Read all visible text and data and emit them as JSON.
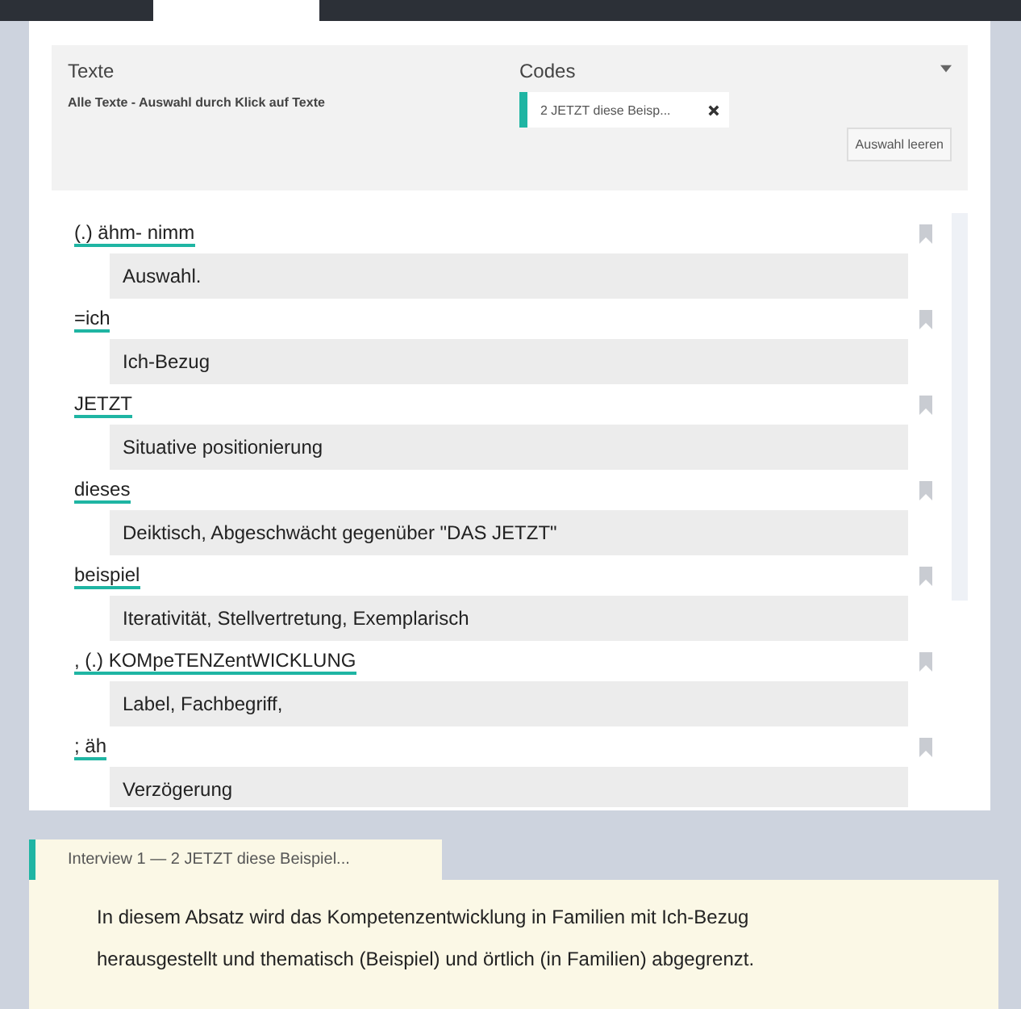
{
  "filter": {
    "texts_label": "Texte",
    "texts_value": "Alle Texte - Auswahl durch Klick auf Texte",
    "codes_label": "Codes",
    "codes": [
      {
        "label": "2 JETZT diese Beisp...",
        "color": "#1fb5a3"
      }
    ],
    "clear_button": "Auswahl leeren"
  },
  "segments": [
    {
      "text": "(.) ähm- nimm",
      "memo": "Auswahl."
    },
    {
      "text": "=ich",
      "memo": "Ich-Bezug"
    },
    {
      "text": "JETZT",
      "memo": "Situative positionierung"
    },
    {
      "text": "dieses",
      "memo": "Deiktisch, Abgeschwächt gegenüber \"DAS JETZT\""
    },
    {
      "text": "beispiel",
      "memo": "Iterativität, Stellvertretung, Exemplarisch"
    },
    {
      "text": ", (.) KOMpeTENZentWICKLUNG",
      "memo": "Label, Fachbegriff,"
    },
    {
      "text": "; äh",
      "memo": "Verzögerung"
    }
  ],
  "memo_panel": {
    "tab": "Interview 1 — 2 JETZT diese Beispiel...",
    "text": "In diesem Absatz wird das Kompetenzentwicklung in Familien mit Ich-Bezug herausgestellt und thematisch (Beispiel) und örtlich (in Familien) abgegrenzt."
  }
}
